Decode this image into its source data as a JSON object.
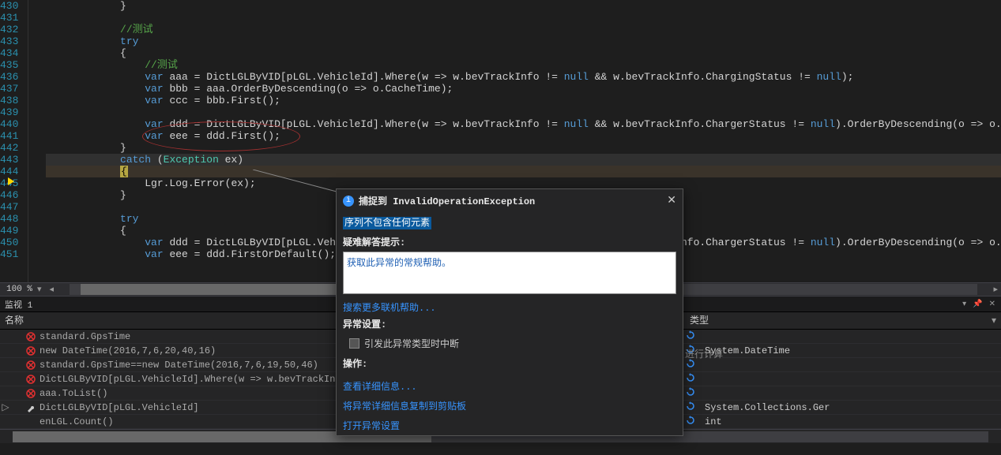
{
  "zoom": "100 %",
  "lines": [
    {
      "n": 430,
      "t": "            }"
    },
    {
      "n": 431,
      "t": ""
    },
    {
      "n": 432,
      "t": "            //测试",
      "comment": true
    },
    {
      "n": 433,
      "t": "            try",
      "kw": [
        "try"
      ]
    },
    {
      "n": 434,
      "t": "            {"
    },
    {
      "n": 435,
      "t": "                //测试",
      "comment": true
    },
    {
      "n": 436,
      "t": "                var aaa = DictLGLByVID[pLGL.VehicleId].Where(w => w.bevTrackInfo != null && w.bevTrackInfo.ChargingStatus != null);"
    },
    {
      "n": 437,
      "t": "                var bbb = aaa.OrderByDescending(o => o.CacheTime);"
    },
    {
      "n": 438,
      "t": "                var ccc = bbb.First();"
    },
    {
      "n": 439,
      "t": ""
    },
    {
      "n": 440,
      "t": "                var ddd = DictLGLByVID[pLGL.VehicleId].Where(w => w.bevTrackInfo != null && w.bevTrackInfo.ChargerStatus != null).OrderByDescending(o => o.CacheTime);"
    },
    {
      "n": 441,
      "t": "                var eee = ddd.First();"
    },
    {
      "n": 442,
      "t": "            }"
    },
    {
      "n": 443,
      "t": "            catch (Exception ex)",
      "hl": "443"
    },
    {
      "n": 444,
      "t": "            {",
      "hl": "444",
      "box": true
    },
    {
      "n": 445,
      "t": "                Lgr.Log.Error(ex);"
    },
    {
      "n": 446,
      "t": "            }"
    },
    {
      "n": 447,
      "t": ""
    },
    {
      "n": 448,
      "t": "            try",
      "kw": [
        "try"
      ]
    },
    {
      "n": 449,
      "t": "            {"
    },
    {
      "n": 450,
      "t": "                var ddd = DictLGLByVID[pLGL.VehicleId].Where(w => w.bevTrackInfo != null && w.bevTrackInfo.ChargerStatus != null).OrderByDescending(o => o.CacheTime);"
    },
    {
      "n": 451,
      "t": "                var eee = ddd.FirstOrDefault();"
    }
  ],
  "hidden_text_right": "rStatus != null).OrderByDescending(o => o.CacheTime);",
  "watch": {
    "title": "监视 1",
    "col_name": "名称",
    "col_type": "类型",
    "rows": [
      {
        "icon": "err",
        "name": "standard.GpsTime",
        "type": ""
      },
      {
        "icon": "err",
        "name": "new DateTime(2016,7,6,20,40,16)",
        "type": "System.DateTime"
      },
      {
        "icon": "err",
        "name": "standard.GpsTime==new DateTime(2016,7,6,19,50,46)",
        "type": ""
      },
      {
        "icon": "err",
        "name": "DictLGLByVID[pLGL.VehicleId].Where(w => w.bevTrackInfo != null &&",
        "type": ""
      },
      {
        "icon": "err",
        "name": "aaa.ToList()",
        "type": ""
      },
      {
        "icon": "wrench",
        "expand": "▷",
        "name": "DictLGLByVID[pLGL.VehicleId]",
        "type": "System.Collections.Ger"
      },
      {
        "icon": "none",
        "name": "enLGL.Count()",
        "type": "int"
      }
    ],
    "hidden_val": "进行计算"
  },
  "popup": {
    "title_prefix": "捕捉到",
    "exception": "InvalidOperationException",
    "message": "序列不包含任何元素",
    "hint_label": "疑难解答提示:",
    "hint_link": "获取此异常的常规帮助。",
    "more_help": "搜索更多联机帮助...",
    "settings_label": "异常设置:",
    "checkbox_label": "引发此异常类型时中断",
    "actions_label": "操作:",
    "action1": "查看详细信息...",
    "action2": "将异常详细信息复制到剪贴板",
    "action3": "打开异常设置"
  }
}
